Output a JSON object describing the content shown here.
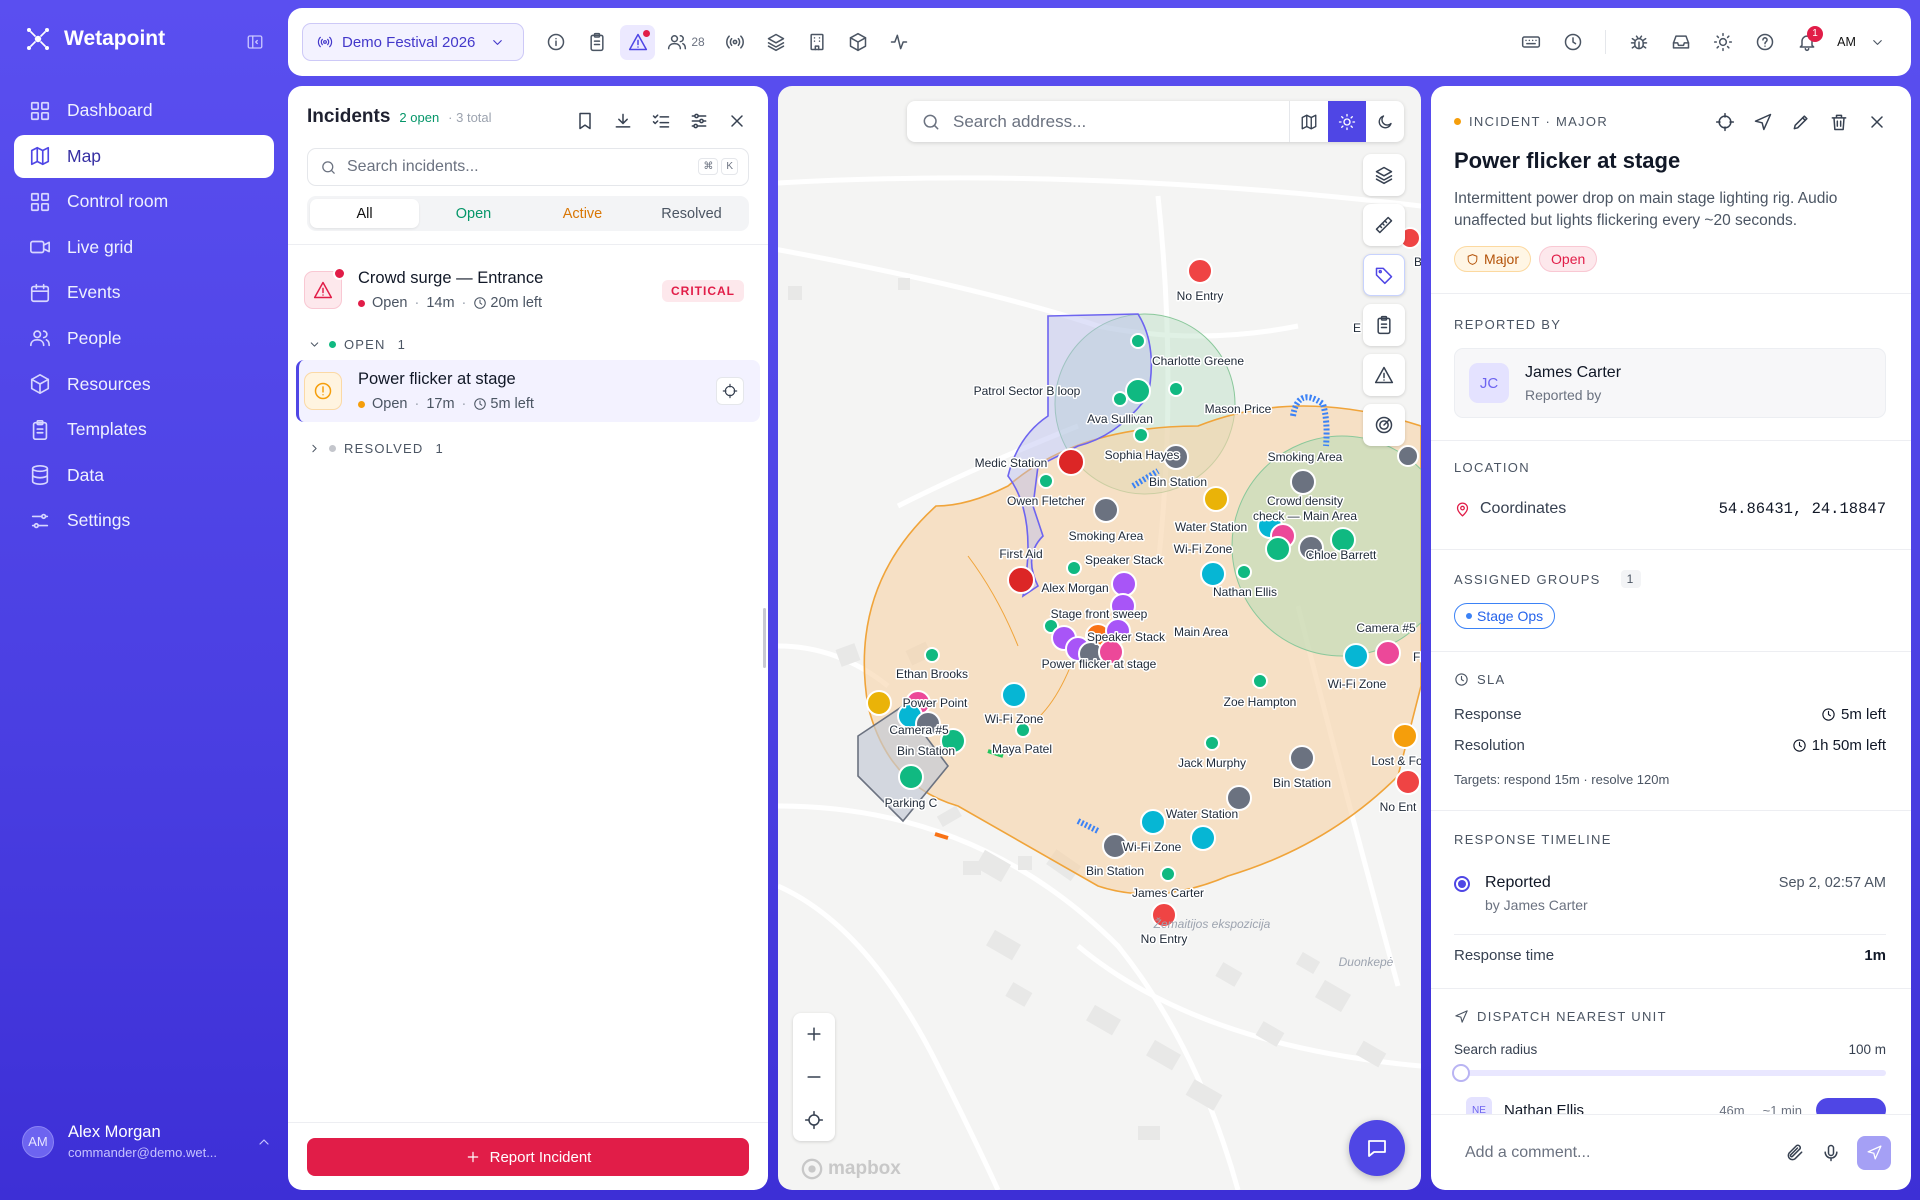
{
  "app": {
    "name": "Wetapoint"
  },
  "sidebar": {
    "items": [
      {
        "label": "Dashboard",
        "icon": "dashboard-icon"
      },
      {
        "label": "Map",
        "icon": "map-icon",
        "active": true
      },
      {
        "label": "Control room",
        "icon": "control-room-icon"
      },
      {
        "label": "Live grid",
        "icon": "video-icon"
      },
      {
        "label": "Events",
        "icon": "calendar-icon"
      },
      {
        "label": "People",
        "icon": "people-icon"
      },
      {
        "label": "Resources",
        "icon": "box-icon"
      },
      {
        "label": "Templates",
        "icon": "clipboard-icon"
      },
      {
        "label": "Data",
        "icon": "database-icon"
      },
      {
        "label": "Settings",
        "icon": "sliders-icon"
      }
    ],
    "user": {
      "initials": "AM",
      "name": "Alex Morgan",
      "email": "commander@demo.wet..."
    }
  },
  "topbar": {
    "event": "Demo Festival 2026",
    "people_count": "28",
    "notifications_count": "1",
    "user_initials": "AM"
  },
  "incidents": {
    "title": "Incidents",
    "open_count": "2 open",
    "total": "· 3 total",
    "search_placeholder": "Search incidents...",
    "shortcut": [
      "⌘",
      "K"
    ],
    "filters": [
      "All",
      "Open",
      "Active",
      "Resolved"
    ],
    "pinned": {
      "title": "Crowd surge — Entrance",
      "status": "Open",
      "age": "14m",
      "sla": "20m left",
      "badge": "CRITICAL"
    },
    "groups": {
      "open": {
        "label": "OPEN",
        "count": "1"
      },
      "resolved": {
        "label": "RESOLVED",
        "count": "1"
      }
    },
    "open_items": [
      {
        "title": "Power flicker at stage",
        "status": "Open",
        "age": "17m",
        "sla": "5m left"
      }
    ],
    "report_button": "Report Incident"
  },
  "map": {
    "search_placeholder": "Search address...",
    "attribution": "mapbox",
    "labels": {
      "no_entry_1": "No Entry",
      "charlotte": "Charlotte Greene",
      "patrol": "Patrol Sector B loop",
      "ava": "Ava Sullivan",
      "mason": "Mason Price",
      "medic": "Medic Station",
      "sophia": "Sophia Hayes",
      "owen": "Owen Fletcher",
      "bin_1": "Bin Station",
      "smoking_1": "Smoking Area",
      "crowd": "Crowd density",
      "crowd2": "check — Main Area",
      "smoking_2": "Smoking Area",
      "water_1": "Water Station",
      "wifi_1": "Wi-Fi Zone",
      "chloe": "Chloe Barrett",
      "first_aid": "First Aid",
      "speaker_1": "Speaker Stack",
      "alex": "Alex Morgan",
      "nathan": "Nathan Ellis",
      "stage_sweep": "Stage front sweep",
      "speaker_2": "Speaker Stack",
      "main_area": "Main Area",
      "power_flicker": "Power flicker at stage",
      "camera_5a": "Camera #5",
      "ethan": "Ethan Brooks",
      "power_point": "Power Point",
      "camera_5b": "Camera #5",
      "wifi_2": "Wi-Fi Zone",
      "wifi_3": "Wi-Fi Zone",
      "zoe": "Zoe Hampton",
      "bin_2": "Bin Station",
      "maya": "Maya Patel",
      "parking": "Parking C",
      "jack": "Jack Murphy",
      "bin_3": "Bin Station",
      "lost": "Lost & Fo",
      "no_entry_2": "No Ent",
      "water_2": "Water Station",
      "wifi_4": "Wi-Fi Zone",
      "bin_4": "Bin Station",
      "james": "James Carter",
      "no_entry_3": "No Entry",
      "place_1": "Žemaitijos ekspozicija",
      "place_2": "Duonkepė",
      "fr": "Fr",
      "bin_top": "Bi",
      "e_label": "E"
    }
  },
  "detail": {
    "kind": "INCIDENT · MAJOR",
    "title": "Power flicker at stage",
    "description": "Intermittent power drop on main stage lighting rig. Audio unaffected but lights flickering every ~20 seconds.",
    "severity": "Major",
    "status": "Open",
    "reported_by": {
      "section": "REPORTED BY",
      "initials": "JC",
      "name": "James Carter",
      "role": "Reported by"
    },
    "location": {
      "section": "LOCATION",
      "label": "Coordinates",
      "value": "54.86431, 24.18847"
    },
    "groups": {
      "section": "ASSIGNED GROUPS",
      "count": "1",
      "items": [
        "Stage Ops"
      ]
    },
    "sla": {
      "section": "SLA",
      "response_label": "Response",
      "response_value": "5m left",
      "resolution_label": "Resolution",
      "resolution_value": "1h 50m left",
      "targets": "Targets: respond 15m · resolve 120m"
    },
    "timeline": {
      "section": "RESPONSE TIMELINE",
      "event": "Reported",
      "by": "by James Carter",
      "time": "Sep 2, 02:57 AM",
      "response_time_label": "Response time",
      "response_time_value": "1m"
    },
    "dispatch": {
      "section": "DISPATCH NEAREST UNIT",
      "radius_label": "Search radius",
      "radius_value": "100 m",
      "radius_fraction": 0.0,
      "partial_unit": "Nathan Ellis",
      "partial_initials": "NE",
      "partial_dist": "46m",
      "partial_eta": "~1 min"
    },
    "comment_placeholder": "Add a comment..."
  },
  "colors": {
    "accent": "#4f46e5",
    "critical": "#e11d48",
    "major": "#f59e0b",
    "open": "#10b981"
  }
}
